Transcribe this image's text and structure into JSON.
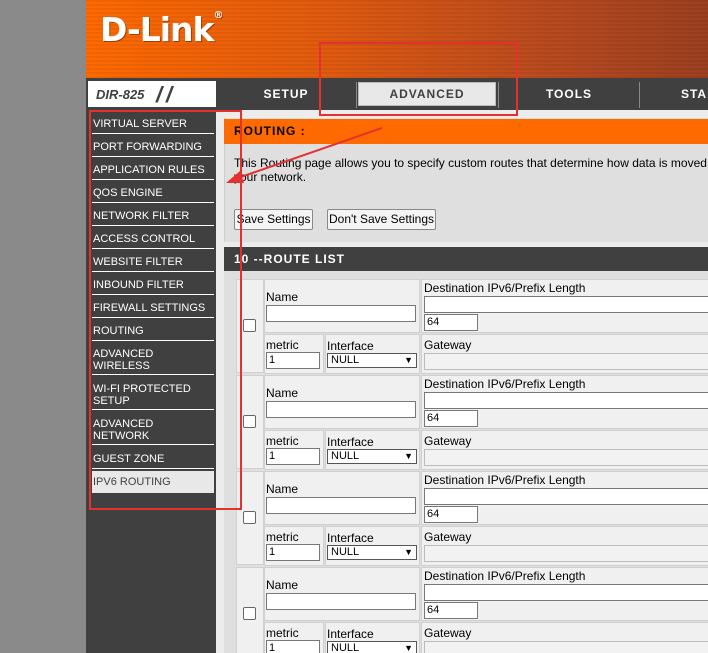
{
  "brand": {
    "logo": "D-Link",
    "reg": "®",
    "model": "DIR-825"
  },
  "tabs": [
    "SETUP",
    "ADVANCED",
    "TOOLS",
    "STA"
  ],
  "sidebar": [
    "VIRTUAL SERVER",
    "PORT FORWARDING",
    "APPLICATION RULES",
    "QOS ENGINE",
    "NETWORK FILTER",
    "ACCESS CONTROL",
    "WEBSITE FILTER",
    "INBOUND FILTER",
    "FIREWALL SETTINGS",
    "ROUTING",
    "ADVANCED\nWIRELESS",
    "WI-FI PROTECTED\nSETUP",
    "ADVANCED\nNETWORK",
    "GUEST ZONE",
    "IPV6 ROUTING"
  ],
  "routing": {
    "title": "ROUTING :",
    "desc_line1": "This Routing page allows you to specify custom routes that determine how data is moved",
    "desc_line2": "your network.",
    "save": "Save Settings",
    "dont_save": "Don't Save Settings"
  },
  "route_list": {
    "title": "10 --ROUTE LIST",
    "labels": {
      "name": "Name",
      "dest": "Destination IPv6/Prefix Length",
      "metric": "metric",
      "interface": "Interface",
      "gateway": "Gateway"
    },
    "rows": [
      {
        "prefix": "64",
        "metric": "1",
        "interface": "NULL"
      },
      {
        "prefix": "64",
        "metric": "1",
        "interface": "NULL"
      },
      {
        "prefix": "64",
        "metric": "1",
        "interface": "NULL"
      },
      {
        "prefix": "64",
        "metric": "1",
        "interface": "NULL"
      }
    ]
  },
  "colors": {
    "orange": "#ff6a00",
    "dark": "#404040",
    "annotation": "#e53030"
  }
}
